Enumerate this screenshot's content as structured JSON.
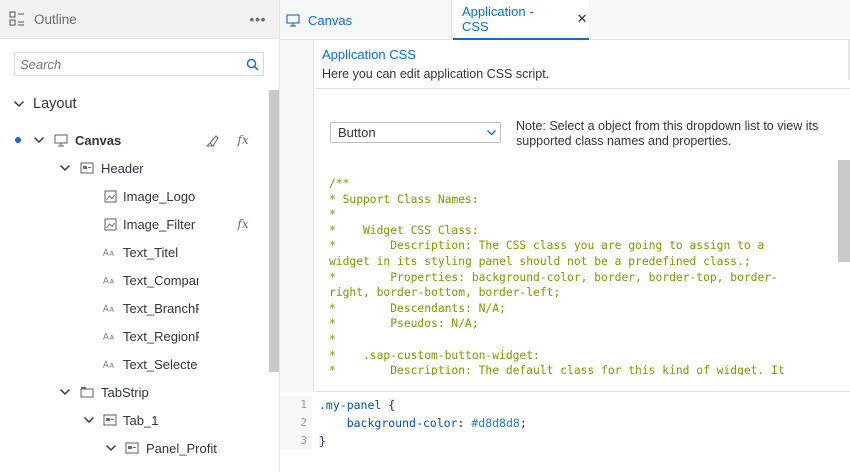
{
  "outline": {
    "title": "Outline",
    "more_label": "•••",
    "search": {
      "placeholder": "Search"
    },
    "section": "Layout",
    "tree": [
      {
        "label": "Canvas"
      },
      {
        "label": "Header"
      },
      {
        "label": "Image_Logo"
      },
      {
        "label": "Image_Filter"
      },
      {
        "label": "Text_Titel"
      },
      {
        "label": "Text_Compar"
      },
      {
        "label": "Text_BranchF"
      },
      {
        "label": "Text_RegionF"
      },
      {
        "label": "Text_Selecte"
      },
      {
        "label": "TabStrip"
      },
      {
        "label": "Tab_1"
      },
      {
        "label": "Panel_Profit"
      }
    ],
    "fx_label": "fx"
  },
  "tabs": [
    {
      "label": "Canvas"
    },
    {
      "label": "Application - CSS",
      "close": "✕"
    }
  ],
  "css_panel": {
    "title": "Application CSS",
    "description": "Here you can edit application CSS script.",
    "class_select": {
      "value": "Button"
    },
    "note": "Note: Select a object from this dropdown list to view its supported class names and properties.",
    "doc_comment": "/**\n* Support Class Names:\n*\n*    Widget CSS Class:\n*        Description: The CSS class you are going to assign to a\nwidget in its styling panel should not be a predefined class.;\n*        Properties: background-color, border, border-top, border-\nright, border-bottom, border-left;\n*        Descendants: N/A;\n*        Pseudos: N/A;\n*\n*    .sap-custom-button-widget:\n*        Description: The default class for this kind of widget. It"
  },
  "editor": {
    "lines": [
      {
        "num": "1",
        "selector": ".my-panel",
        "brace": "{"
      },
      {
        "num": "2",
        "property": "background-color",
        "colon": ":",
        "value": "#d8d8d8",
        "semi": ";"
      },
      {
        "num": "3",
        "brace": "}"
      }
    ]
  },
  "colors": {
    "accent": "#0a6ed1",
    "comment": "#7a9a00",
    "dot": "#0a6ed1"
  }
}
